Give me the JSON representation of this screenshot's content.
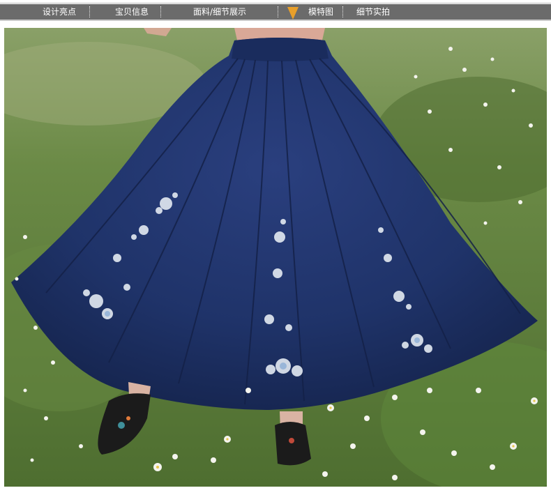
{
  "nav": {
    "tabs": [
      {
        "label": "设计亮点"
      },
      {
        "label": "宝贝信息"
      },
      {
        "label": "面料/细节展示"
      },
      {
        "label": "模特图"
      },
      {
        "label": "细节实拍"
      }
    ],
    "active_tab": "模特图"
  },
  "colors": {
    "nav_bar": "#6b6b6b",
    "nav_text": "#ffffff",
    "active_marker": "#e89f2a",
    "skirt": "#1d2f63",
    "grass": "#5e7d3c"
  },
  "photo": {
    "subject": "model-photo"
  }
}
